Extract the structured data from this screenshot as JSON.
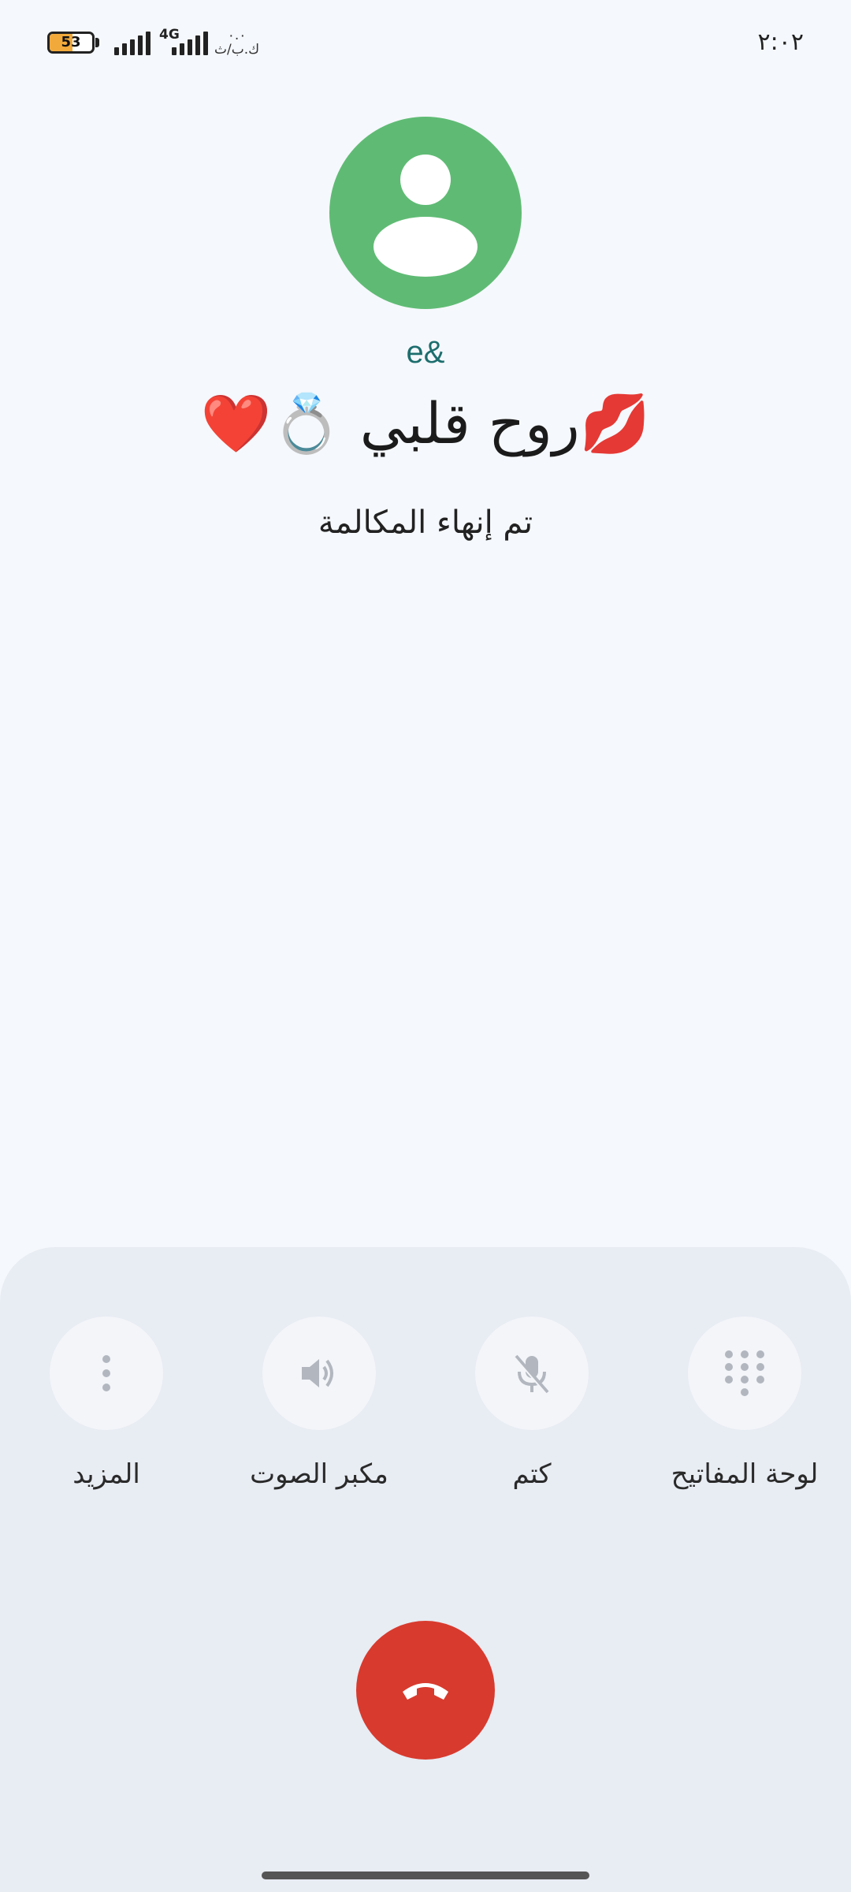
{
  "status_bar": {
    "battery_level": "53",
    "battery_fraction": 0.53,
    "network_type": "4G",
    "data_speed_value": "٠.٠",
    "data_speed_unit": "ك.ب/ث",
    "time": "٢:٠٢"
  },
  "call": {
    "avatar_icon": "person-icon",
    "carrier": "e&",
    "contact_name": "💋روح قلبي 💍❤️",
    "status": "تم إنهاء المكالمة"
  },
  "controls": {
    "keypad_label": "لوحة المفاتيح",
    "mute_label": "كتم",
    "speaker_label": "مكبر الصوت",
    "more_label": "المزيد",
    "end_call_icon": "phone-hangup-icon"
  },
  "colors": {
    "background": "#f5f8fc",
    "avatar": "#5fbb74",
    "carrier_text": "#1d6e6e",
    "panel": "#e8ecf3",
    "end_call": "#d83a2e"
  }
}
